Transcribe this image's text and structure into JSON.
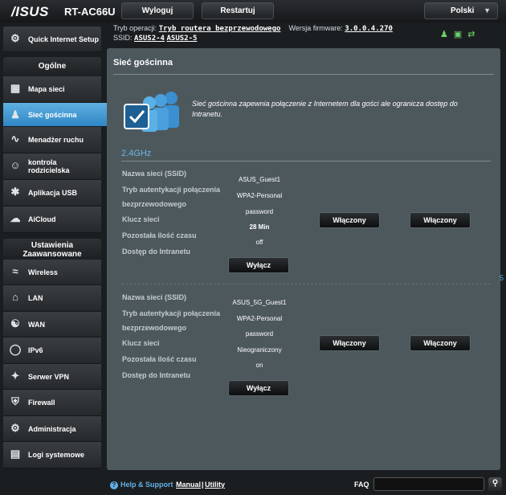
{
  "header": {
    "logo": "/ISUS",
    "model": "RT-AC66U",
    "logout_label": "Wyloguj",
    "restart_label": "Restartuj",
    "language": "Polski"
  },
  "info": {
    "mode_label": "Tryb operacji:",
    "mode_value": "Tryb routera bezprzewodowego",
    "firmware_label": "Wersja firmware:",
    "firmware_value": "3.0.0.4.270",
    "ssid_label": "SSID:",
    "ssid_1": "ASUS2-4",
    "ssid_2": "ASUS2-5"
  },
  "sidebar": {
    "quick": "Quick Internet Setup",
    "general_header": "Ogólne",
    "general_items": [
      {
        "label": "Mapa sieci",
        "icon": "network-map-icon"
      },
      {
        "label": "Sieć gościnna",
        "icon": "guest-network-icon"
      },
      {
        "label": "Menadżer ruchu",
        "icon": "traffic-manager-icon"
      },
      {
        "label": "kontrola rodzicielska",
        "icon": "parental-control-icon"
      },
      {
        "label": "Aplikacja USB",
        "icon": "usb-app-icon"
      },
      {
        "label": "AiCloud",
        "icon": "aicloud-icon"
      }
    ],
    "advanced_header": "Ustawienia Zaawansowane",
    "advanced_items": [
      {
        "label": "Wireless",
        "icon": "wireless-icon"
      },
      {
        "label": "LAN",
        "icon": "lan-icon"
      },
      {
        "label": "WAN",
        "icon": "wan-icon"
      },
      {
        "label": "IPv6",
        "icon": "ipv6-icon"
      },
      {
        "label": "Serwer VPN",
        "icon": "vpn-icon"
      },
      {
        "label": "Firewall",
        "icon": "firewall-icon"
      },
      {
        "label": "Administracja",
        "icon": "administration-icon"
      },
      {
        "label": "Logi systemowe",
        "icon": "system-log-icon"
      }
    ]
  },
  "main": {
    "title": "Sieć gościnna",
    "description": "Sieć gościnna zapewnia połączenie z Internetem dla gości ale ogranicza dostęp do Intranetu.",
    "band_label": "2.4GHz",
    "labels": {
      "ssid": "Nazwa sieci (SSID)",
      "auth_1": "Tryb autentykacji połączenia",
      "auth_2": "bezprzewodowego",
      "key": "Klucz sieci",
      "time": "Pozostała ilość czasu",
      "intranet": "Dostęp do Intranetu"
    },
    "profile_1": {
      "ssid": "ASUS_Guest1",
      "auth": "WPA2-Personal",
      "key": "password",
      "time": "28 Min",
      "intranet": "off",
      "disable_label": "Wyłącz",
      "enabled_1": "Włączony",
      "enabled_2": "Włączony"
    },
    "profile_2": {
      "ssid": "ASUS_5G_Guest1",
      "auth": "WPA2-Personal",
      "key": "password",
      "time": "Nieograniczony",
      "intranet": "on",
      "disable_label": "Wyłącz",
      "enabled_1": "Włączony",
      "enabled_2": "Włączony"
    }
  },
  "footer": {
    "help": "Help & Support",
    "manual": "Manual",
    "separator": "|",
    "utility": "Utility",
    "faq": "FAQ",
    "search_value": ""
  },
  "edge_mark": "5"
}
